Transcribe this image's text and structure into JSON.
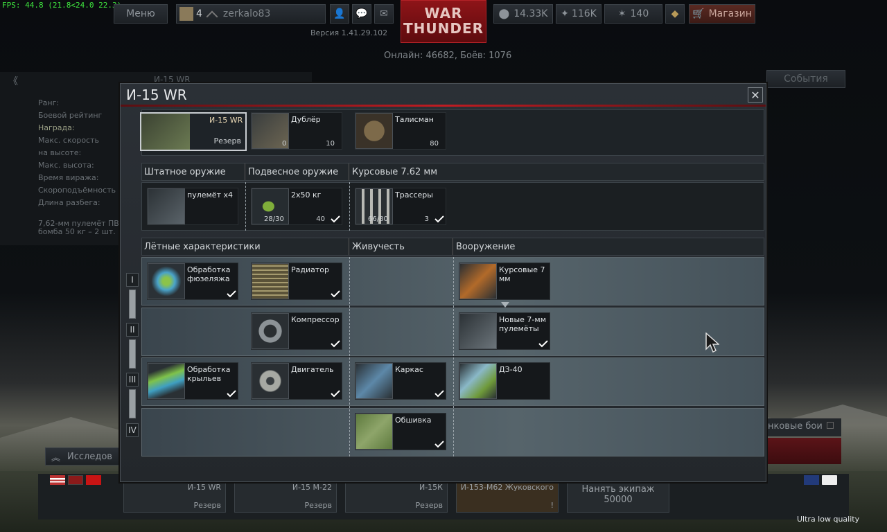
{
  "fps": "FPS: 44.8 (21.8<24.0 22.3)",
  "header": {
    "menu": "Меню",
    "rank": "4",
    "username": "zerkalo83",
    "version": "Версия 1.41.29.102",
    "online": "Онлайн: 46682, Боёв: 1076",
    "logo_line1": "WAR",
    "logo_line2": "THUNDER",
    "silver_lions": "14.33K",
    "research": "116K",
    "golden_eagles": "140",
    "shop": "Магазин",
    "events": "События"
  },
  "left_info": {
    "name": "И-15 WR",
    "rows": [
      "Ранг:",
      "Боевой рейтинг",
      "Награда:",
      "Макс. скорость",
      "на высоте:",
      "Макс. высота:",
      "Время виража:",
      "Скороподъёмность",
      "Длина разбега:"
    ],
    "weapons1": "7,62-мм пулемёт ПВ",
    "weapons2": "бомба 50 кг – 2 шт."
  },
  "dialog": {
    "title": "И-15 WR",
    "top_cards": [
      {
        "name": "И-15 WR",
        "sub": "Резерв"
      },
      {
        "name": "Дублёр",
        "qty": "0",
        "price": "10"
      },
      {
        "name": "Талисман",
        "price": "80"
      }
    ],
    "weapon_headers": [
      "Штатное оружие",
      "Подвесное оружие",
      "Курсовые 7.62 мм"
    ],
    "weapons": [
      {
        "name": "пулемёт x4"
      },
      {
        "name": "2x50 кг",
        "qty": "28/30",
        "price": "40"
      },
      {
        "name": "Трассеры",
        "qty": "66/80",
        "price": "3"
      }
    ],
    "mod_headers": [
      "Лётные характеристики",
      "Живучесть",
      "Вооружение"
    ],
    "ranks": [
      "I",
      "II",
      "III",
      "IV"
    ],
    "mods": {
      "r1": [
        "Обработка фюзеляжа",
        "Радиатор",
        "Курсовые 7 мм"
      ],
      "r2": [
        "Компрессор",
        "Новые 7-мм пулемёты"
      ],
      "r3": [
        "Обработка крыльев",
        "Двигатель",
        "Каркас",
        "ДЗ-40"
      ],
      "r4": [
        "Обшивка"
      ]
    }
  },
  "bottom": {
    "research_tab": "Исследов",
    "tank_battles": "нковые бои",
    "hire_crew": "Нанять экипаж",
    "hire_cost": "50000",
    "quality": "Ultra low quality",
    "slots": [
      {
        "name": "И-15 WR",
        "sub": "Резерв"
      },
      {
        "name": "И-15 М-22",
        "sub": "Резерв"
      },
      {
        "name": "И-15К",
        "sub": "Резерв"
      },
      {
        "name": "И-153-М62 Жуковского",
        "sub": "!"
      }
    ]
  }
}
